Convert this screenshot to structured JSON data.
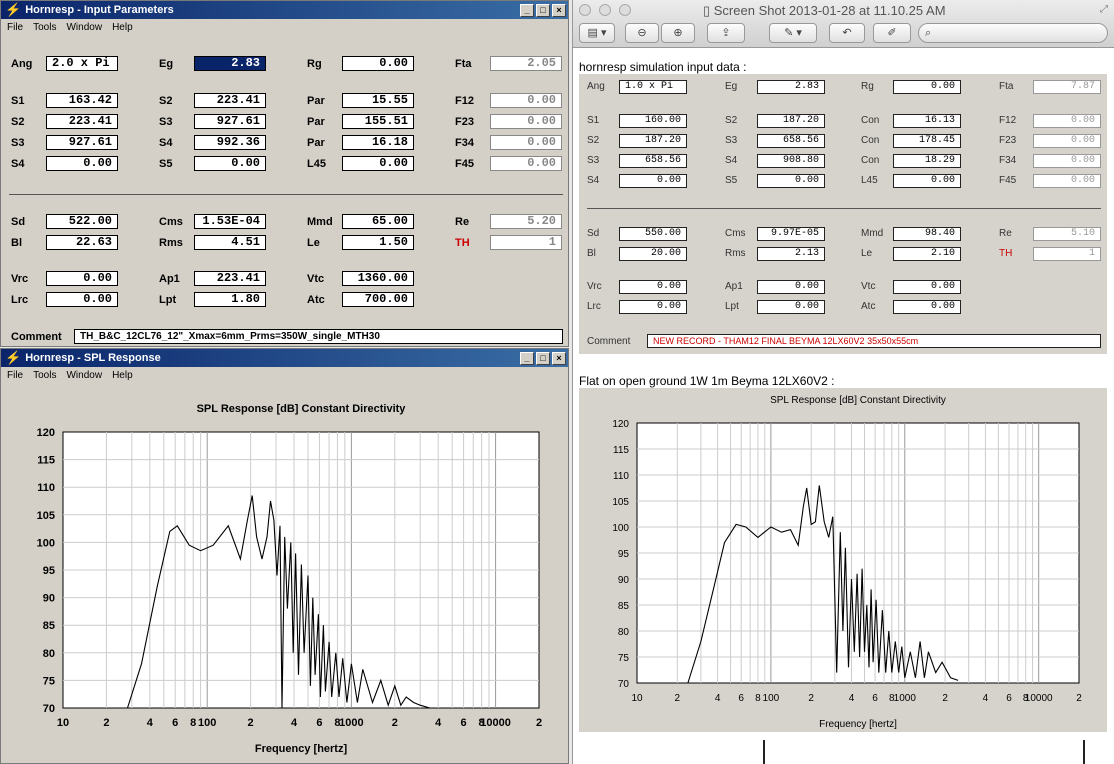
{
  "left_params": {
    "title": "Hornresp - Input Parameters",
    "menu": [
      "File",
      "Tools",
      "Window",
      "Help"
    ],
    "rows": [
      {
        "l1": "Ang",
        "v1": "2.0 x Pi",
        "l2": "Eg",
        "v2": "2.83",
        "l3": "Rg",
        "v3": "0.00",
        "l4": "Fta",
        "v4": "2.05"
      },
      {
        "l1": "S1",
        "v1": "163.42",
        "l2": "S2",
        "v2": "223.41",
        "l3": "Par",
        "v3": "15.55",
        "l4": "F12",
        "v4": "0.00"
      },
      {
        "l1": "S2",
        "v1": "223.41",
        "l2": "S3",
        "v2": "927.61",
        "l3": "Par",
        "v3": "155.51",
        "l4": "F23",
        "v4": "0.00"
      },
      {
        "l1": "S3",
        "v1": "927.61",
        "l2": "S4",
        "v2": "992.36",
        "l3": "Par",
        "v3": "16.18",
        "l4": "F34",
        "v4": "0.00"
      },
      {
        "l1": "S4",
        "v1": "0.00",
        "l2": "S5",
        "v2": "0.00",
        "l3": "L45",
        "v3": "0.00",
        "l4": "F45",
        "v4": "0.00"
      },
      {
        "l1": "Sd",
        "v1": "522.00",
        "l2": "Cms",
        "v2": "1.53E-04",
        "l3": "Mmd",
        "v3": "65.00",
        "l4": "Re",
        "v4": "5.20"
      },
      {
        "l1": "Bl",
        "v1": "22.63",
        "l2": "Rms",
        "v2": "4.51",
        "l3": "Le",
        "v3": "1.50",
        "l4": "TH",
        "v4": "1"
      },
      {
        "l1": "Vrc",
        "v1": "0.00",
        "l2": "Ap1",
        "v2": "223.41",
        "l3": "Vtc",
        "v3": "1360.00"
      },
      {
        "l1": "Lrc",
        "v1": "0.00",
        "l2": "Lpt",
        "v2": "1.80",
        "l3": "Atc",
        "v3": "700.00"
      }
    ],
    "comment_label": "Comment",
    "comment": "TH_B&C_12CL76_12\"_Xmax=6mm_Prms=350W_single_MTH30"
  },
  "left_spl": {
    "title": "Hornresp - SPL Response",
    "menu": [
      "File",
      "Tools",
      "Window",
      "Help"
    ]
  },
  "right": {
    "window_title": "Screen Shot 2013-01-28 at 11.10.25 AM",
    "heading": "hornresp simulation input data :",
    "rows": [
      {
        "l1": "Ang",
        "v1": "1.0 x Pi",
        "l2": "Eg",
        "v2": "2.83",
        "l3": "Rg",
        "v3": "0.00",
        "l4": "Fta",
        "v4": "7.87"
      },
      {
        "l1": "S1",
        "v1": "160.00",
        "l2": "S2",
        "v2": "187.20",
        "l3": "Con",
        "v3": "16.13",
        "l4": "F12",
        "v4": "0.00"
      },
      {
        "l1": "S2",
        "v1": "187.20",
        "l2": "S3",
        "v2": "658.56",
        "l3": "Con",
        "v3": "178.45",
        "l4": "F23",
        "v4": "0.00"
      },
      {
        "l1": "S3",
        "v1": "658.56",
        "l2": "S4",
        "v2": "908.80",
        "l3": "Con",
        "v3": "18.29",
        "l4": "F34",
        "v4": "0.00"
      },
      {
        "l1": "S4",
        "v1": "0.00",
        "l2": "S5",
        "v2": "0.00",
        "l3": "L45",
        "v3": "0.00",
        "l4": "F45",
        "v4": "0.00"
      },
      {
        "l1": "Sd",
        "v1": "550.00",
        "l2": "Cms",
        "v2": "9.97E-05",
        "l3": "Mmd",
        "v3": "98.40",
        "l4": "Re",
        "v4": "5.10"
      },
      {
        "l1": "Bl",
        "v1": "20.00",
        "l2": "Rms",
        "v2": "2.13",
        "l3": "Le",
        "v3": "2.10",
        "l4": "TH",
        "v4": "1"
      },
      {
        "l1": "Vrc",
        "v1": "0.00",
        "l2": "Ap1",
        "v2": "0.00",
        "l3": "Vtc",
        "v3": "0.00"
      },
      {
        "l1": "Lrc",
        "v1": "0.00",
        "l2": "Lpt",
        "v2": "0.00",
        "l3": "Atc",
        "v3": "0.00"
      }
    ],
    "comment_label": "Comment",
    "comment": "NEW RECORD - THAM12 FINAL BEYMA 12LX60V2 35x50x55cm",
    "subheading": "Flat on open ground 1W 1m Beyma 12LX60V2 :"
  },
  "chart_data": [
    {
      "type": "line",
      "title": "SPL Response [dB]   Constant Directivity",
      "xlabel": "Frequency [hertz]",
      "ylabel": "",
      "x_scale": "log",
      "xlim": [
        10,
        20000
      ],
      "ylim": [
        70,
        120
      ],
      "yticks": [
        120,
        115,
        110,
        105,
        100,
        95,
        90,
        85,
        80,
        75,
        70
      ],
      "xticks": [
        "10",
        "2",
        "4",
        "6",
        "8",
        "100",
        "2",
        "4",
        "6",
        "8",
        "1000",
        "2",
        "4",
        "6",
        "8",
        "10000",
        "2"
      ],
      "grid": true,
      "series": [
        {
          "x": [
            28,
            35,
            45,
            55,
            62,
            75,
            90,
            110,
            140,
            170,
            190,
            205,
            220,
            240,
            260,
            275,
            290,
            305,
            320,
            330,
            345,
            360,
            380,
            395,
            410,
            430,
            450,
            470,
            500,
            520,
            540,
            560,
            590,
            610,
            640,
            660,
            700,
            730,
            780,
            820,
            870,
            930,
            1000,
            1100,
            1200,
            1400,
            1600,
            1800,
            2000,
            2200,
            2400,
            2700,
            3000,
            3500
          ],
          "y": [
            70,
            78,
            92,
            102,
            103,
            99.5,
            98.5,
            99.5,
            103,
            97,
            104,
            108.5,
            101,
            97,
            101,
            107.5,
            104,
            94,
            103,
            70,
            101,
            88,
            100,
            80,
            98,
            76,
            96,
            80,
            94,
            74,
            90,
            76,
            87,
            72,
            85,
            73,
            82,
            72,
            80,
            72,
            79,
            71,
            78,
            71,
            77,
            71,
            75,
            70.5,
            74,
            70.5,
            72,
            71,
            70.5,
            70
          ]
        }
      ]
    },
    {
      "type": "line",
      "title": "SPL Response [dB]   Constant Directivity",
      "xlabel": "Frequency [hertz]",
      "ylabel": "",
      "x_scale": "log",
      "xlim": [
        10,
        20000
      ],
      "ylim": [
        70,
        120
      ],
      "yticks": [
        120,
        115,
        110,
        105,
        100,
        95,
        90,
        85,
        80,
        75,
        70
      ],
      "xticks": [
        "10",
        "2",
        "4",
        "6",
        "8",
        "100",
        "2",
        "4",
        "6",
        "8",
        "1000",
        "2",
        "4",
        "6",
        "8",
        "10000",
        "2"
      ],
      "grid": true,
      "series": [
        {
          "x": [
            24,
            30,
            38,
            45,
            55,
            65,
            80,
            100,
            120,
            140,
            160,
            175,
            185,
            200,
            215,
            230,
            250,
            270,
            290,
            310,
            330,
            345,
            360,
            380,
            400,
            420,
            440,
            460,
            480,
            500,
            520,
            540,
            560,
            580,
            610,
            640,
            680,
            720,
            760,
            800,
            850,
            900,
            950,
            1000,
            1100,
            1200,
            1300,
            1400,
            1500,
            1700,
            1900,
            2200,
            2500
          ],
          "y": [
            70,
            78,
            89,
            97,
            100.5,
            100,
            98,
            100,
            99,
            99.5,
            96.5,
            104,
            107.5,
            100.5,
            101,
            108,
            101,
            98,
            102,
            72,
            99,
            80,
            96,
            73,
            90,
            76,
            91,
            75,
            92,
            76,
            85,
            73,
            88,
            74,
            86,
            72,
            84,
            72,
            80,
            72,
            78,
            72,
            77,
            71,
            76,
            71,
            78,
            71,
            76,
            72,
            74,
            71,
            70.5
          ]
        }
      ]
    }
  ]
}
